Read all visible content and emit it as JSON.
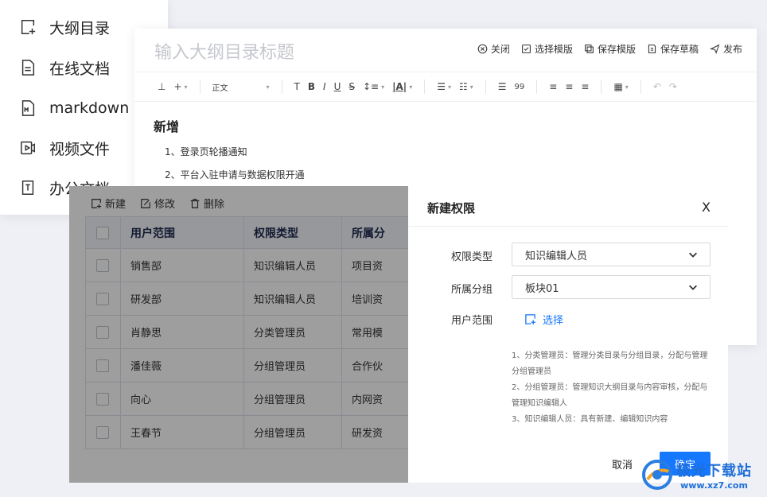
{
  "menu": {
    "items": [
      {
        "label": "大纲目录",
        "icon": "outline-add-icon"
      },
      {
        "label": "在线文档",
        "icon": "document-icon"
      },
      {
        "label": "markdown",
        "icon": "markdown-icon"
      },
      {
        "label": "视频文件",
        "icon": "video-file-icon"
      },
      {
        "label": "办公文档",
        "icon": "office-document-icon"
      }
    ]
  },
  "editor": {
    "title_placeholder": "输入大纲目录标题",
    "actions": {
      "close": "关闭",
      "select_template": "选择模版",
      "save_template": "保存模版",
      "save_draft": "保存草稿",
      "publish": "发布"
    },
    "toolbar": {
      "paragraph_style": "正文",
      "quote_count": "99"
    },
    "content": {
      "heading": "新增",
      "lines": [
        "1、登录页轮播通知",
        "2、平台入驻申请与数据权限开通"
      ]
    }
  },
  "panel": {
    "tools": {
      "new": "新建",
      "edit": "修改",
      "delete": "删除"
    },
    "columns": [
      "用户范围",
      "权限类型",
      "所属分"
    ],
    "rows": [
      {
        "user": "销售部",
        "type": "知识编辑人员",
        "group": "项目资"
      },
      {
        "user": "研发部",
        "type": "知识编辑人员",
        "group": "培训资"
      },
      {
        "user": "肖静思",
        "type": "分类管理员",
        "group": "常用模"
      },
      {
        "user": "潘佳薇",
        "type": "分组管理员",
        "group": "合作伙"
      },
      {
        "user": "向心",
        "type": "分组管理员",
        "group": "内网资"
      },
      {
        "user": "王春节",
        "type": "分组管理员",
        "group": "研发资"
      }
    ]
  },
  "dialog": {
    "title": "新建权限",
    "close": "X",
    "permission_type_label": "权限类型",
    "permission_type_value": "知识编辑人员",
    "group_label": "所属分组",
    "group_value": "板块01",
    "user_scope_label": "用户范围",
    "select_label": "选择",
    "notes": [
      "1、分类管理员：管理分类目录与分组目录，分配与管理分组管理员",
      "2、分组管理员：管理知识大纲目录与内容审核，分配与管理知识编辑人",
      "3、知识编辑人员：具有新建、编辑知识内容"
    ],
    "cancel": "取消",
    "ok": "确定"
  },
  "watermark": {
    "name": "极光下载站",
    "url": "www.xz7.com"
  },
  "colors": {
    "accent": "#1677ff",
    "overlay": "rgba(0,0,0,0.38)"
  }
}
